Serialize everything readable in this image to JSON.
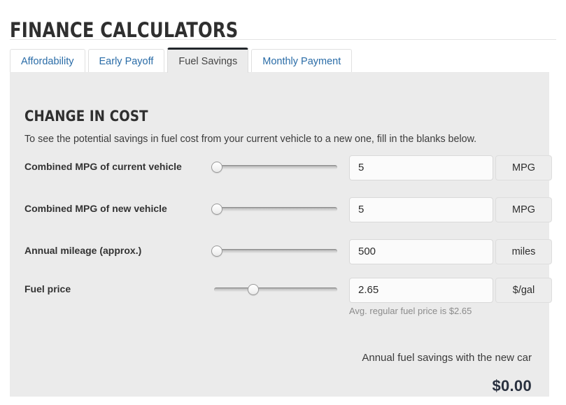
{
  "header": {
    "title": "FINANCE CALCULATORS"
  },
  "tabs": [
    {
      "label": "Affordability",
      "active": false
    },
    {
      "label": "Early Payoff",
      "active": false
    },
    {
      "label": "Fuel Savings",
      "active": true
    },
    {
      "label": "Monthly Payment",
      "active": false
    }
  ],
  "panel": {
    "section_title": "CHANGE IN COST",
    "intro": "To see the potential savings in fuel cost from your current vehicle to a new one, fill in the blanks below."
  },
  "rows": [
    {
      "label": "Combined MPG of current vehicle",
      "slider_percent": 2,
      "value": "5",
      "unit": "MPG",
      "help": ""
    },
    {
      "label": "Combined MPG of new vehicle",
      "slider_percent": 2,
      "value": "5",
      "unit": "MPG",
      "help": ""
    },
    {
      "label": "Annual mileage (approx.)",
      "slider_percent": 2,
      "value": "500",
      "unit": "miles",
      "help": ""
    },
    {
      "label": "Fuel price",
      "slider_percent": 32,
      "value": "2.65",
      "unit": "$/gal",
      "help": "Avg. regular fuel price is $2.65"
    }
  ],
  "result": {
    "label": "Annual fuel savings with the new car",
    "value": "$0.00"
  },
  "colors": {
    "panel_bg": "#ebebeb",
    "tab_link": "#2a6ca7",
    "active_tab_border": "#22262b",
    "result_value": "#29313f",
    "help_text": "#8b8b8b"
  }
}
